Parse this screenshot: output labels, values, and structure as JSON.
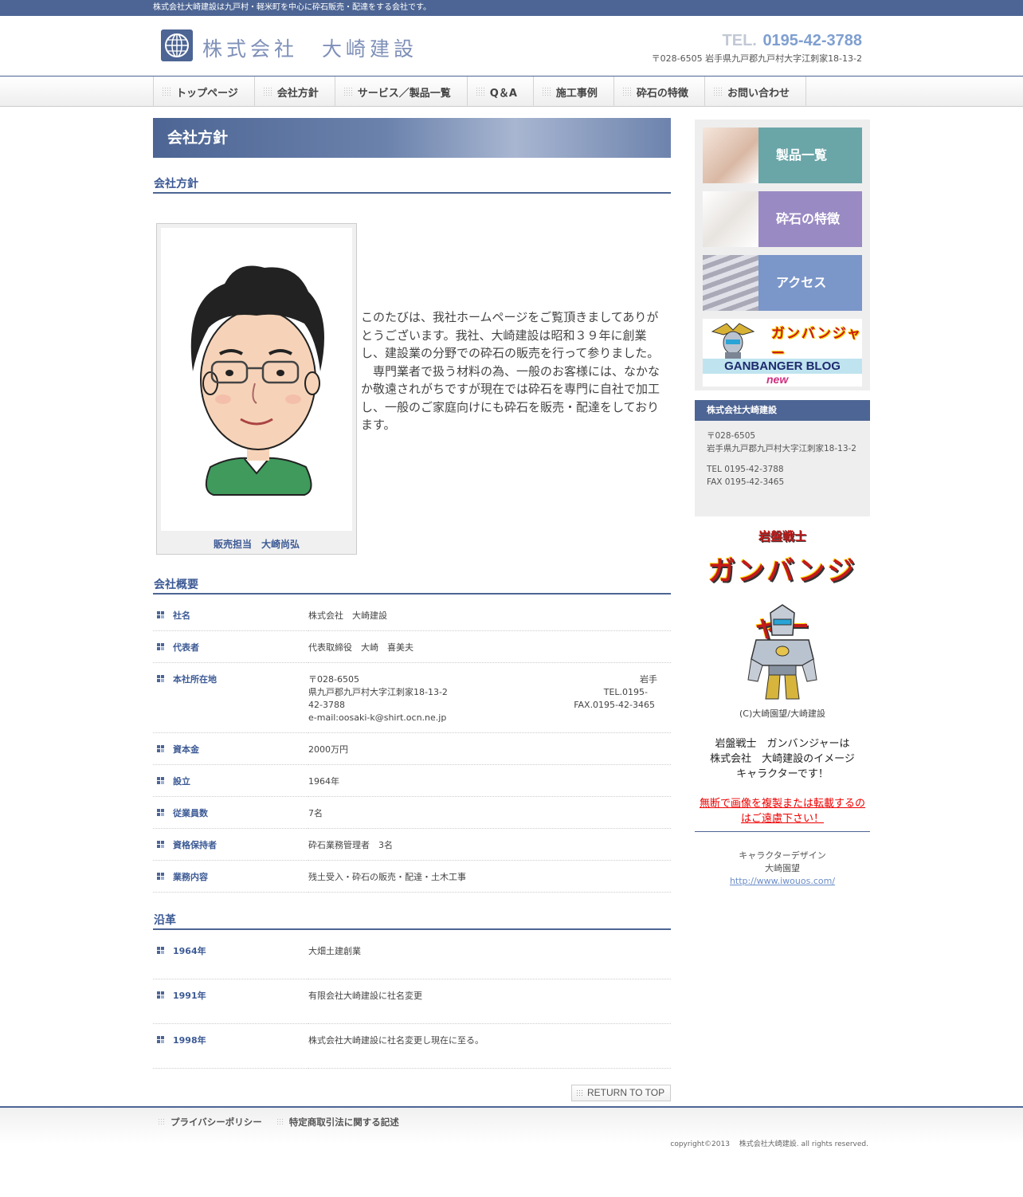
{
  "topbar": {
    "text": "株式会社大崎建設は九戸村・軽米町を中心に砕石販売・配達をする会社です。"
  },
  "header": {
    "logo_text": "株式会社　大崎建設",
    "tel_label": "TEL.",
    "tel_number": "0195-42-3788",
    "address": "〒028-6505 岩手県九戸郡九戸村大字江刺家18-13-2"
  },
  "nav": [
    {
      "label": "トップページ"
    },
    {
      "label": "会社方針"
    },
    {
      "label": "サービス／製品一覧"
    },
    {
      "label": "Q＆A"
    },
    {
      "label": "施工事例"
    },
    {
      "label": "砕石の特徴"
    },
    {
      "label": "お問い合わせ"
    }
  ],
  "main": {
    "page_title": "会社方針",
    "policy_heading": "会社方針",
    "photo_caption": "販売担当　大崎尚弘",
    "intro_p1": "このたびは、我社ホームページをご覧頂きましてありがとうございます。我社、大崎建設は昭和３９年に創業し、建設業の分野での砕石の販売を行って参りました。",
    "intro_p2": "　専門業者で扱う材料の為、一般のお客様には、なかなか敬遠されがちですが現在では砕石を専門に自社で加工し、一般のご家庭向けにも砕石を販売・配達をしております。",
    "overview_heading": "会社概要",
    "overview": [
      {
        "key": "社名",
        "value": "株式会社　大崎建設"
      },
      {
        "key": "代表者",
        "value": "代表取締役　大崎　喜美夫"
      },
      {
        "key": "本社所在地",
        "line1": "〒028-6505",
        "line1r": "岩手",
        "line2": "県九戸郡九戸村大字江刺家18-13-2",
        "line2r": "TEL.0195-",
        "line3": "42-3788",
        "line3r": "FAX.0195-42-3465",
        "line4": "e-mail:oosaki-k@shirt.ocn.ne.jp"
      },
      {
        "key": "資本金",
        "value": "2000万円"
      },
      {
        "key": "設立",
        "value": "1964年"
      },
      {
        "key": "従業員数",
        "value": "7名"
      },
      {
        "key": "資格保持者",
        "value": "砕石業務管理者　3名"
      },
      {
        "key": "業務内容",
        "value": "残土受入・砕石の販売・配達・土木工事"
      }
    ],
    "history_heading": "沿革",
    "history": [
      {
        "year": "1964年",
        "event": "大畑土建創業"
      },
      {
        "year": "1991年",
        "event": "有限会社大崎建設に社名変更"
      },
      {
        "year": "1998年",
        "event": "株式会社大崎建設に社名変更し現在に至る。"
      }
    ],
    "return_top": "RETURN TO TOP"
  },
  "side": {
    "banners": [
      {
        "label": "製品一覧"
      },
      {
        "label": "砕石の特徴"
      },
      {
        "label": "アクセス"
      }
    ],
    "blog_banner": {
      "logo": "ガンバンジャー",
      "text": "GANBANGER BLOG",
      "new": "new"
    },
    "company_box": {
      "title": "株式会社大崎建設",
      "postal": "〒028-6505",
      "address": "岩手県九戸郡九戸村大字江刺家18-13-2",
      "tel": "TEL 0195-42-3788",
      "fax": "FAX 0195-42-3465"
    },
    "hero": {
      "sub": "岩盤戦士",
      "title": "ガンバンジャー",
      "credit": "(C)大崎園望/大崎建設"
    },
    "about_line1": "岩盤戦士　ガンバンジャーは",
    "about_line2": "株式会社　大崎建設のイメージ",
    "about_line3": "キャラクターです！",
    "warning_line1": "無断で画像を複製または転載するの",
    "warning_line2": "はご遠慮下さい！",
    "design_label": "キャラクターデザイン",
    "design_name": "大崎園望",
    "design_link": "http://www.iwouos.com/"
  },
  "footer": {
    "links": [
      {
        "label": "プライバシーポリシー"
      },
      {
        "label": "特定商取引法に関する記述"
      }
    ],
    "copyright": "copyright©2013　 株式会社大崎建設. all rights reserved."
  }
}
